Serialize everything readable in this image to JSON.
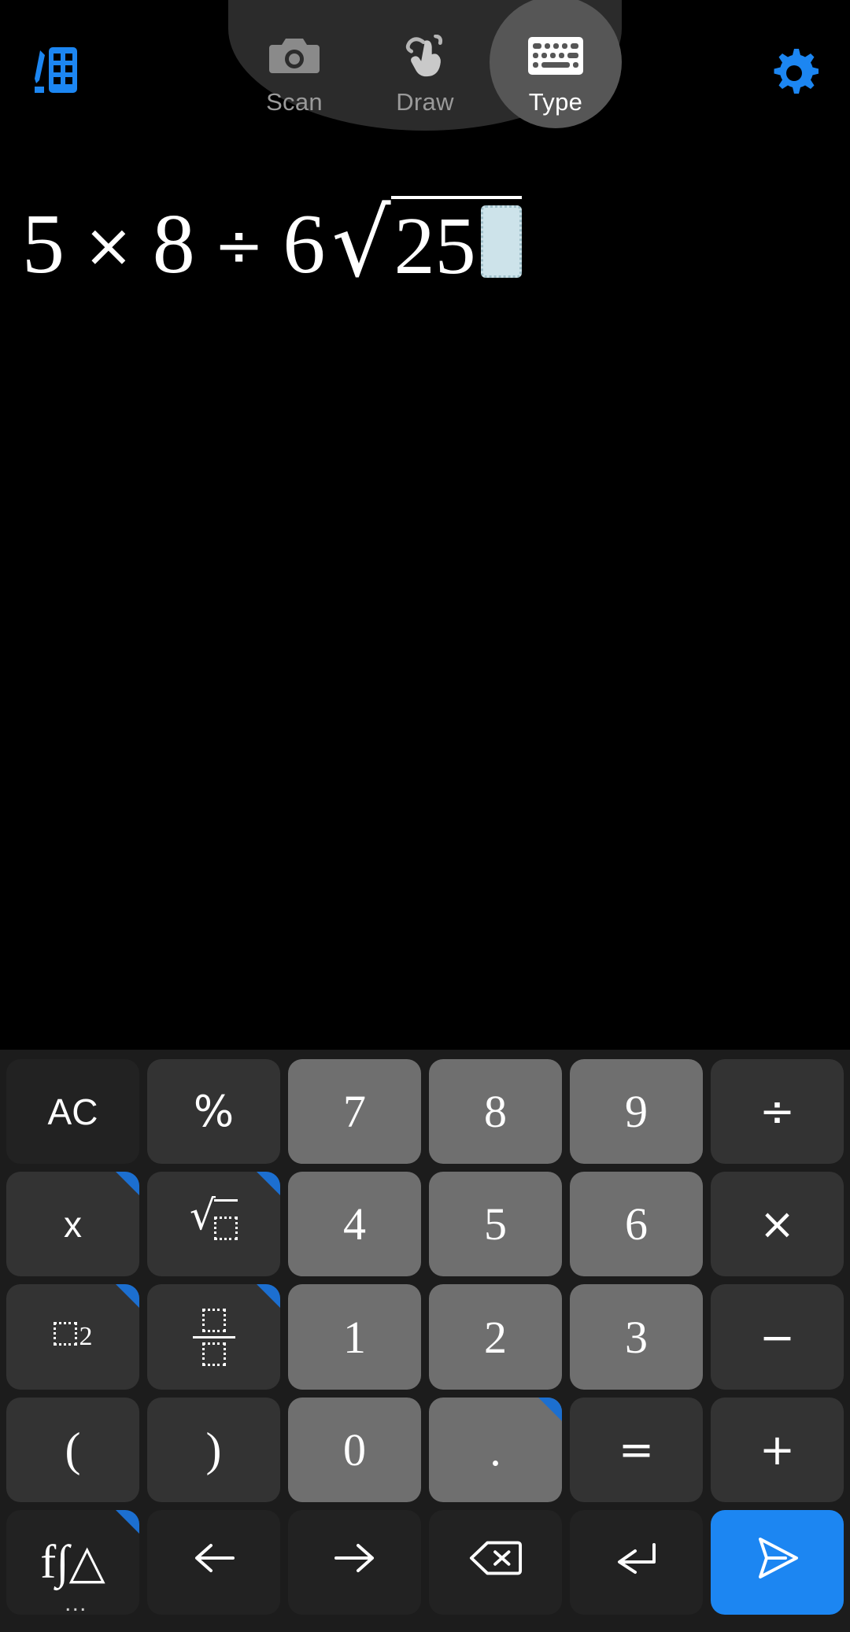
{
  "app": {
    "accent_color": "#1c86f2",
    "background": "#000000",
    "keypad_background": "#1c1c1c"
  },
  "topbar": {
    "notes_icon": "notes-pencil-icon",
    "settings_icon": "gear-icon",
    "modes": [
      {
        "id": "scan",
        "label": "Scan",
        "icon": "camera-icon",
        "active": false
      },
      {
        "id": "draw",
        "label": "Draw",
        "icon": "hand-draw-icon",
        "active": false
      },
      {
        "id": "type",
        "label": "Type",
        "icon": "keyboard-icon",
        "active": true
      }
    ]
  },
  "expression": {
    "plain": "5 × 8 ÷ 6√25",
    "tokens": {
      "n1": "5",
      "op1": "×",
      "n2": "8",
      "op2": "÷",
      "n3": "6",
      "sqrt_symbol": "√",
      "radicand": "25"
    },
    "cursor": {
      "type": "placeholder-box",
      "fill": "#cde3ea",
      "border": "#9fbfc9"
    }
  },
  "keypad": {
    "rows": [
      [
        {
          "label": "AC",
          "name": "key-all-clear",
          "style": "dark",
          "badge": false
        },
        {
          "label": "%",
          "name": "key-percent",
          "style": "fn",
          "badge": false
        },
        {
          "label": "7",
          "name": "key-7",
          "style": "digit",
          "badge": false
        },
        {
          "label": "8",
          "name": "key-8",
          "style": "digit",
          "badge": false
        },
        {
          "label": "9",
          "name": "key-9",
          "style": "digit",
          "badge": false
        },
        {
          "label": "÷",
          "name": "key-divide",
          "style": "fn",
          "badge": false
        }
      ],
      [
        {
          "label": "x",
          "name": "key-variable-x",
          "style": "fn",
          "badge": true
        },
        {
          "label": "√□",
          "name": "key-square-root",
          "style": "fn",
          "badge": true
        },
        {
          "label": "4",
          "name": "key-4",
          "style": "digit",
          "badge": false
        },
        {
          "label": "5",
          "name": "key-5",
          "style": "digit",
          "badge": false
        },
        {
          "label": "6",
          "name": "key-6",
          "style": "digit",
          "badge": false
        },
        {
          "label": "×",
          "name": "key-multiply",
          "style": "fn",
          "badge": false
        }
      ],
      [
        {
          "label": "□²",
          "name": "key-power",
          "style": "fn",
          "badge": true
        },
        {
          "label": "□/□",
          "name": "key-fraction",
          "style": "fn",
          "badge": true
        },
        {
          "label": "1",
          "name": "key-1",
          "style": "digit",
          "badge": false
        },
        {
          "label": "2",
          "name": "key-2",
          "style": "digit",
          "badge": false
        },
        {
          "label": "3",
          "name": "key-3",
          "style": "digit",
          "badge": false
        },
        {
          "label": "−",
          "name": "key-subtract",
          "style": "fn",
          "badge": false
        }
      ],
      [
        {
          "label": "(",
          "name": "key-open-paren",
          "style": "fn",
          "badge": false
        },
        {
          "label": ")",
          "name": "key-close-paren",
          "style": "fn",
          "badge": false
        },
        {
          "label": "0",
          "name": "key-0",
          "style": "digit",
          "badge": false
        },
        {
          "label": ".",
          "name": "key-decimal",
          "style": "digit",
          "badge": true
        },
        {
          "label": "=",
          "name": "key-equals",
          "style": "fn",
          "badge": false
        },
        {
          "label": "+",
          "name": "key-add",
          "style": "fn",
          "badge": false
        }
      ],
      [
        {
          "label": "f∫△",
          "name": "key-functions",
          "style": "dark",
          "badge": true,
          "more": "…"
        },
        {
          "label": "←",
          "name": "key-cursor-left",
          "style": "dark",
          "badge": false
        },
        {
          "label": "→",
          "name": "key-cursor-right",
          "style": "dark",
          "badge": false
        },
        {
          "label": "⌫",
          "name": "key-backspace",
          "style": "dark",
          "badge": false
        },
        {
          "label": "↵",
          "name": "key-newline",
          "style": "dark",
          "badge": false
        },
        {
          "label": "➤",
          "name": "key-submit",
          "style": "accent",
          "badge": false
        }
      ]
    ]
  }
}
